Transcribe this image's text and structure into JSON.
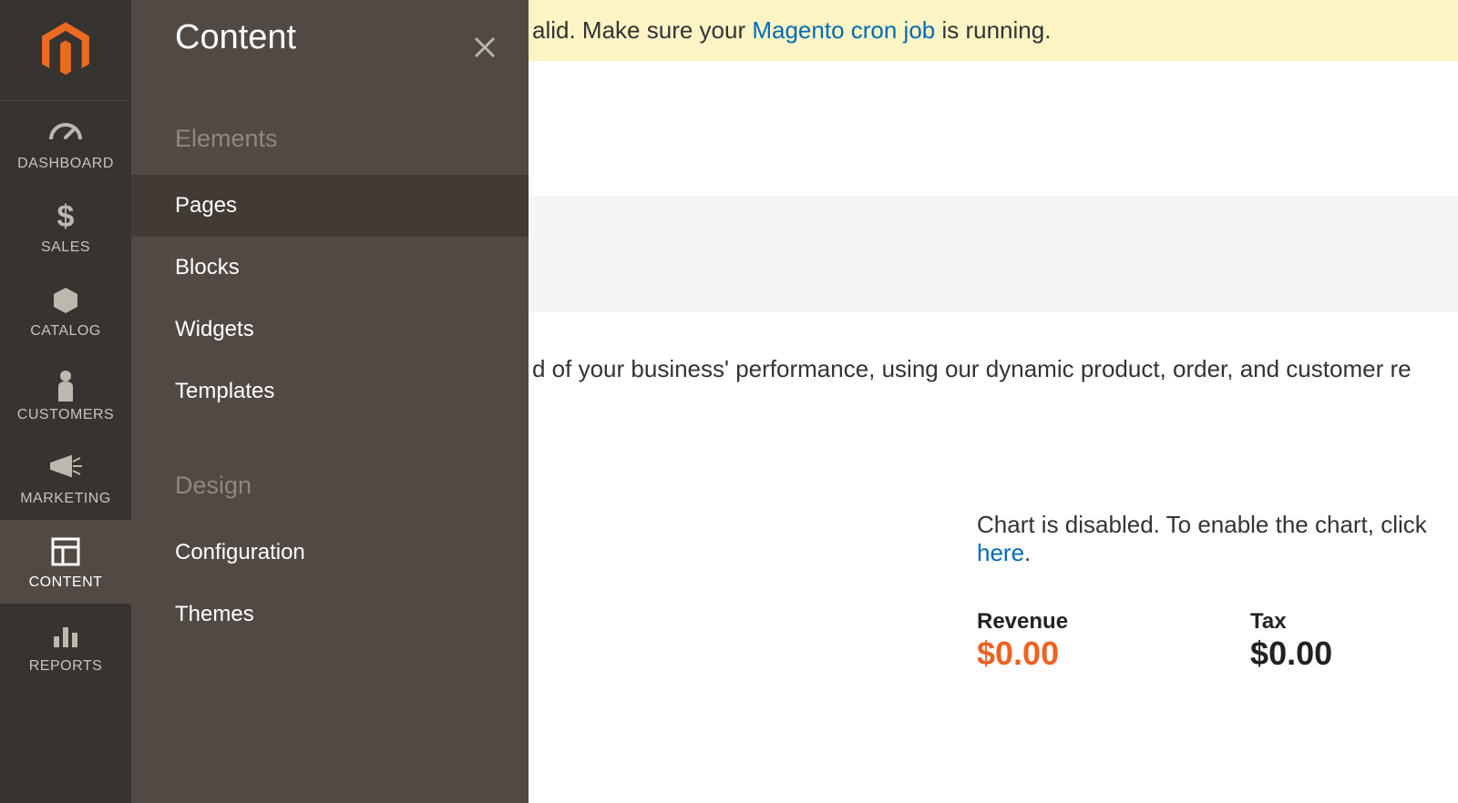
{
  "sidebar": {
    "items": [
      {
        "label": "DASHBOARD"
      },
      {
        "label": "SALES"
      },
      {
        "label": "CATALOG"
      },
      {
        "label": "CUSTOMERS"
      },
      {
        "label": "MARKETING"
      },
      {
        "label": "CONTENT"
      },
      {
        "label": "REPORTS"
      }
    ]
  },
  "flyout": {
    "title": "Content",
    "groups": [
      {
        "title": "Elements",
        "links": [
          "Pages",
          "Blocks",
          "Widgets",
          "Templates"
        ]
      },
      {
        "title": "Design",
        "links": [
          "Configuration",
          "Themes"
        ]
      }
    ]
  },
  "notice": {
    "prefix_fragment": "alid",
    "mid": ". Make sure your ",
    "link_text": "Magento cron job",
    "suffix": " is running."
  },
  "perf_fragment": "d of your business' performance, using our dynamic product, order, and customer re",
  "chart_msg": {
    "text": "Chart is disabled. To enable the chart, click ",
    "link": "here",
    "end": "."
  },
  "stats": {
    "revenue_label": "Revenue",
    "revenue_value": "$0.00",
    "tax_label": "Tax",
    "tax_value": "$0.00"
  }
}
